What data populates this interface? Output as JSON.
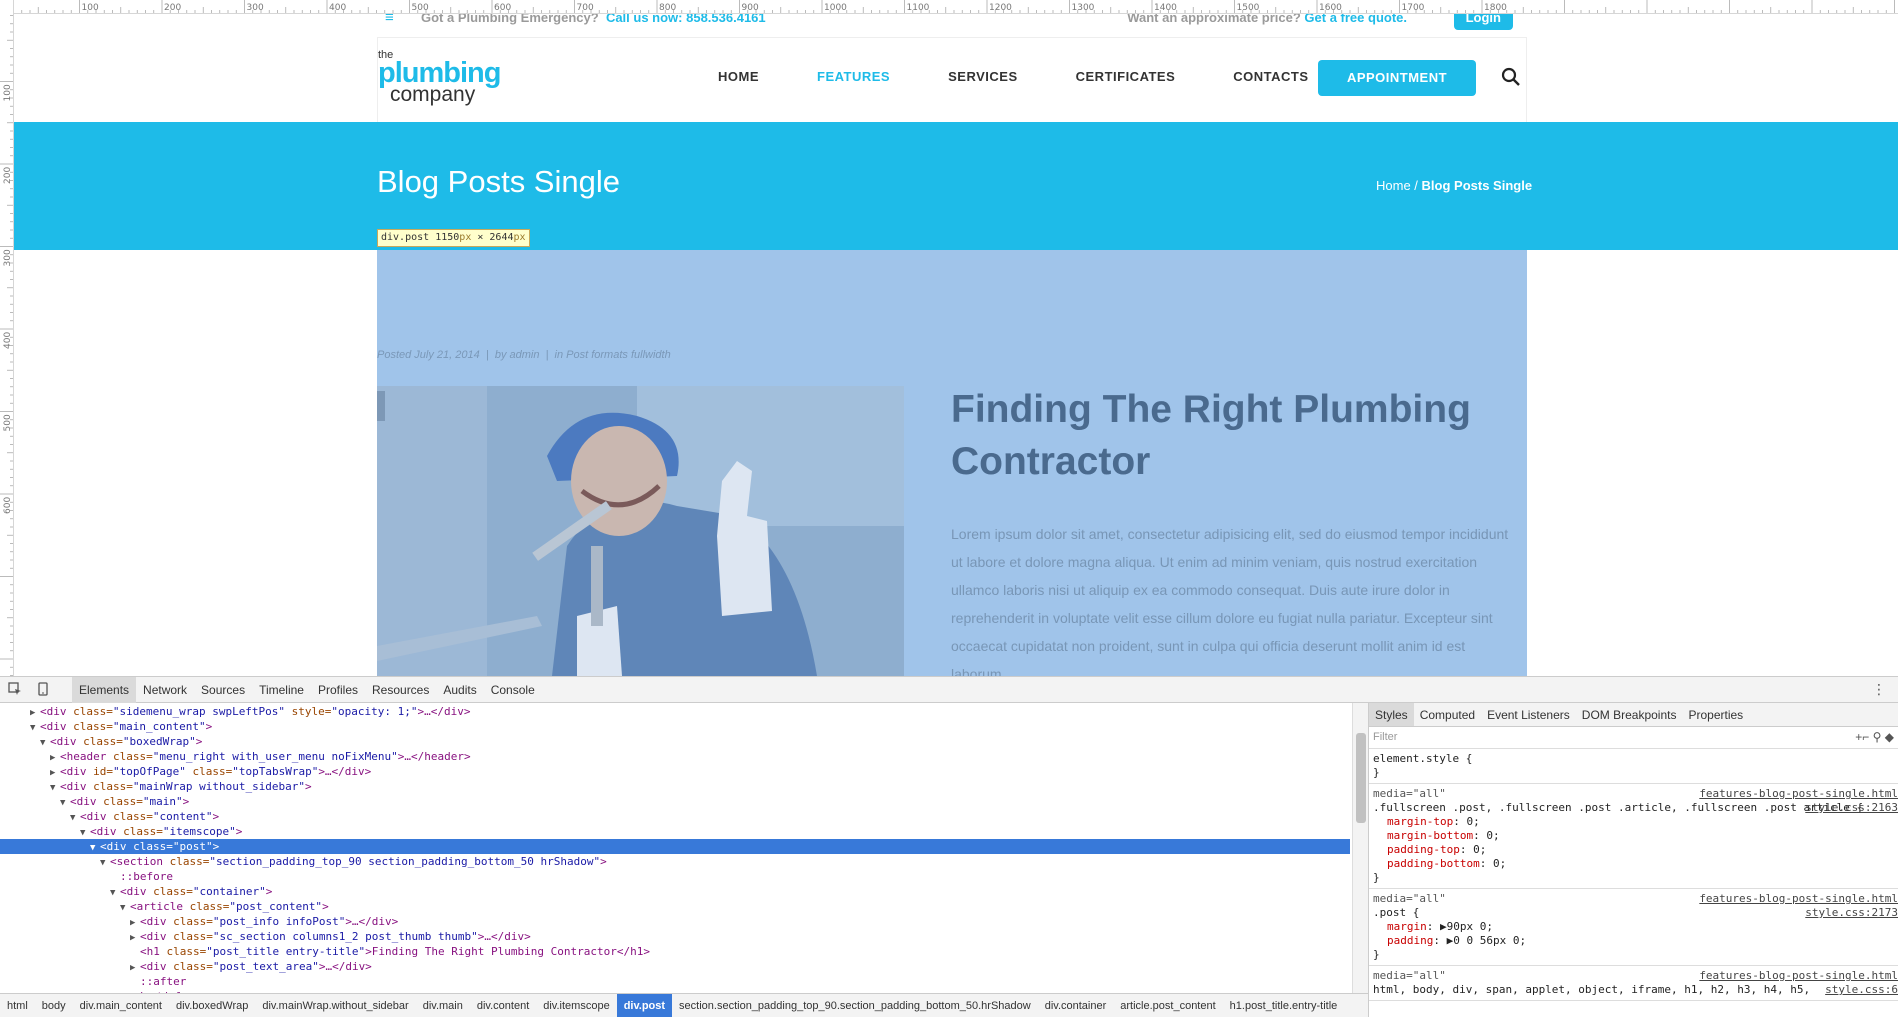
{
  "ruler": {
    "top_labels": [
      "100",
      "200",
      "300",
      "400",
      "500",
      "600",
      "700",
      "800",
      "900",
      "1000",
      "1100",
      "1200",
      "1300",
      "1400",
      "1500",
      "1600",
      "1700",
      "1800"
    ],
    "left_labels": [
      "100",
      "200",
      "300",
      "400",
      "500",
      "600"
    ]
  },
  "site": {
    "emergency_label": "Got a Plumbing Emergency?",
    "emergency_call": "Call us now: 858.536.4161",
    "quote_label": "Want an approximate price?",
    "quote_link": "Get a free quote.",
    "login": "Login",
    "logo_the": "the",
    "logo_plumbing": "plumbing",
    "logo_company": "company",
    "nav": [
      "HOME",
      "FEATURES",
      "SERVICES",
      "CERTIFICATES",
      "CONTACTS"
    ],
    "nav_active": "FEATURES",
    "appointment": "APPOINTMENT",
    "banner_title": "Blog Posts Single",
    "breadcrumb_home": "Home",
    "breadcrumb_sep": " / ",
    "breadcrumb_current": "Blog Posts Single",
    "post_meta": "Posted July 21, 2014  |  by admin  |  in Post formats fullwidth",
    "post_title": "Finding The Right Plumbing Contractor",
    "post_body": "Lorem ipsum dolor sit amet, consectetur adipisicing elit, sed do eiusmod tempor incididunt ut labore et dolore magna aliqua. Ut enim ad minim veniam, quis nostrud exercitation ullamco laboris nisi ut aliquip ex ea commodo consequat. Duis aute irure dolor in reprehenderit in voluptate velit esse cillum dolore eu fugiat nulla pariatur. Excepteur sint occaecat cupidatat non proident, sunt in culpa qui officia deserunt mollit anim id est laborum."
  },
  "inspector_tooltip": {
    "selector": "div.post",
    "width": "1150",
    "height": "2644",
    "unit": "px",
    "times": " × "
  },
  "devtools": {
    "tabs": [
      "Elements",
      "Network",
      "Sources",
      "Timeline",
      "Profiles",
      "Resources",
      "Audits",
      "Console"
    ],
    "active_tab": "Elements",
    "dom_lines": [
      {
        "indent": 2,
        "tw": "▶",
        "tag": "div",
        "attrs": [
          [
            "class",
            "sidemenu_wrap swpLeftPos"
          ],
          [
            "style",
            "opacity: 1;"
          ]
        ],
        "close": ">…</div>"
      },
      {
        "indent": 2,
        "tw": "▼",
        "tag": "div",
        "attrs": [
          [
            "class",
            "main_content"
          ]
        ],
        "close": ">"
      },
      {
        "indent": 3,
        "tw": "▼",
        "tag": "div",
        "attrs": [
          [
            "class",
            "boxedWrap"
          ]
        ],
        "close": ">"
      },
      {
        "indent": 4,
        "tw": "▶",
        "tag": "header",
        "attrs": [
          [
            "class",
            "menu_right with_user_menu noFixMenu"
          ]
        ],
        "close": ">…</header>"
      },
      {
        "indent": 4,
        "tw": "▶",
        "tag": "div",
        "attrs": [
          [
            "id",
            "topOfPage"
          ],
          [
            "class",
            "topTabsWrap"
          ]
        ],
        "close": ">…</div>"
      },
      {
        "indent": 4,
        "tw": "▼",
        "tag": "div",
        "attrs": [
          [
            "class",
            "mainWrap without_sidebar"
          ]
        ],
        "close": ">"
      },
      {
        "indent": 5,
        "tw": "▼",
        "tag": "div",
        "attrs": [
          [
            "class",
            "main"
          ]
        ],
        "close": ">"
      },
      {
        "indent": 6,
        "tw": "▼",
        "tag": "div",
        "attrs": [
          [
            "class",
            "content"
          ]
        ],
        "close": ">"
      },
      {
        "indent": 7,
        "tw": "▼",
        "tag": "div",
        "attrs": [
          [
            "class",
            "itemscope"
          ]
        ],
        "close": ">"
      },
      {
        "indent": 8,
        "tw": "▼",
        "tag": "div",
        "attrs": [
          [
            "class",
            "post"
          ]
        ],
        "close": ">",
        "selected": true
      },
      {
        "indent": 9,
        "tw": "▼",
        "tag": "section",
        "attrs": [
          [
            "class",
            "section_padding_top_90 section_padding_bottom_50 hrShadow"
          ]
        ],
        "close": ">"
      },
      {
        "indent": 10,
        "tw": "",
        "pseudo": "::before"
      },
      {
        "indent": 10,
        "tw": "▼",
        "tag": "div",
        "attrs": [
          [
            "class",
            "container"
          ]
        ],
        "close": ">"
      },
      {
        "indent": 11,
        "tw": "▼",
        "tag": "article",
        "attrs": [
          [
            "class",
            "post_content"
          ]
        ],
        "close": ">"
      },
      {
        "indent": 12,
        "tw": "▶",
        "tag": "div",
        "attrs": [
          [
            "class",
            "post_info infoPost"
          ]
        ],
        "close": ">…</div>"
      },
      {
        "indent": 12,
        "tw": "▶",
        "tag": "div",
        "attrs": [
          [
            "class",
            "sc_section columns1_2 post_thumb thumb"
          ]
        ],
        "close": ">…</div>"
      },
      {
        "indent": 12,
        "tw": "",
        "tag": "h1",
        "attrs": [
          [
            "class",
            "post_title entry-title"
          ]
        ],
        "close": ">Finding The Right Plumbing Contractor</h1>"
      },
      {
        "indent": 12,
        "tw": "▶",
        "tag": "div",
        "attrs": [
          [
            "class",
            "post_text_area"
          ]
        ],
        "close": ">…</div>"
      },
      {
        "indent": 12,
        "tw": "",
        "pseudo": "::after"
      },
      {
        "indent": 11,
        "tw": "",
        "pseudo": "</article>"
      }
    ],
    "breadcrumbs": [
      "html",
      "body",
      "div.main_content",
      "div.boxedWrap",
      "div.mainWrap.without_sidebar",
      "div.main",
      "div.content",
      "div.itemscope",
      "div.post",
      "section.section_padding_top_90.section_padding_bottom_50.hrShadow",
      "div.container",
      "article.post_content",
      "h1.post_title.entry-title"
    ],
    "breadcrumb_active": "div.post",
    "styles_tabs": [
      "Styles",
      "Computed",
      "Event Listeners",
      "DOM Breakpoints",
      "Properties"
    ],
    "styles_active": "Styles",
    "filter_placeholder": "Filter",
    "element_style_selector": "element.style {",
    "rule1_media": "media=\"all\"",
    "rule1_src": "features-blog-post-single.html",
    "rule1_src2": "style.css:2163",
    "rule1_selector": ".fullscreen .post, .fullscreen .post .article, .fullscreen .post article {",
    "rule1_props": [
      [
        "margin-top",
        "0;"
      ],
      [
        "margin-bottom",
        "0;"
      ],
      [
        "padding-top",
        "0;"
      ],
      [
        "padding-bottom",
        "0;"
      ]
    ],
    "rule2_media": "media=\"all\"",
    "rule2_src": "features-blog-post-single.html",
    "rule2_src2": "style.css:2173",
    "rule2_selector": ".post {",
    "rule2_props": [
      [
        "margin",
        "▶90px 0;"
      ],
      [
        "padding",
        "▶0 0 56px 0;"
      ]
    ],
    "rule3_media": "media=\"all\"",
    "rule3_src": "features-blog-post-single.html",
    "rule3_text": "html, body, div, span, applet, object, iframe, h1, h2, h3, h4, h5,",
    "rule3_src2": "style.css:6",
    "close_brace": "}"
  },
  "colors": {
    "brand": "#1ebbe8",
    "highlight_overlay": "#a0c4ea",
    "devtools_selection": "#3879d9"
  }
}
